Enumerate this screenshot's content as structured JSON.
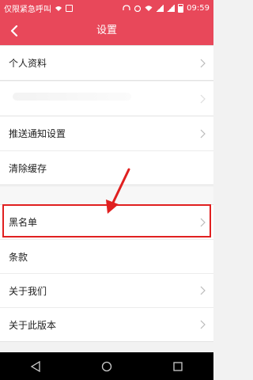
{
  "status_bar": {
    "carrier": "仅限紧急呼叫",
    "time": "09:59"
  },
  "app_bar": {
    "title": "设置",
    "back_icon": "back-arrow-icon"
  },
  "settings": {
    "group1": [
      {
        "label": "个人资料"
      }
    ],
    "group2": [
      {
        "label": "推送通知设置"
      },
      {
        "label": "清除缓存"
      }
    ],
    "group3": [
      {
        "label": "黑名单"
      },
      {
        "label": "条款"
      },
      {
        "label": "关于我们"
      },
      {
        "label": "关于此版本"
      }
    ]
  },
  "annotation": {
    "highlight_color": "#e02020",
    "target": "黑名单"
  },
  "nav_bar": {
    "back": "nav-back-icon",
    "home": "nav-home-icon",
    "recents": "nav-recents-icon"
  },
  "colors": {
    "accent": "#e8485a",
    "background": "#f2f2f2"
  }
}
